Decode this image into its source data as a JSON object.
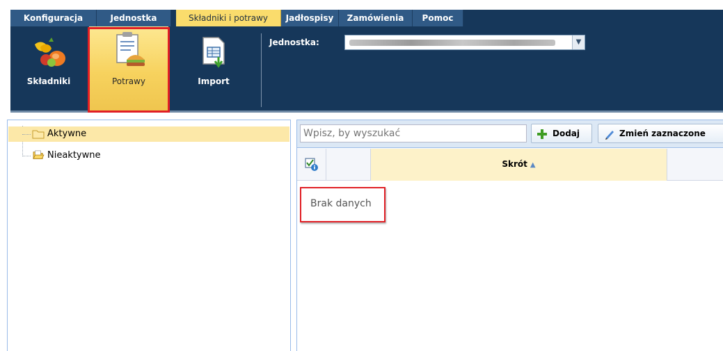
{
  "tabs": [
    {
      "label": "Konfiguracja",
      "active": false
    },
    {
      "label": "Jednostka",
      "active": false
    },
    {
      "label": "Składniki i potrawy",
      "active": true
    },
    {
      "label": "Jadłospisy",
      "active": false
    },
    {
      "label": "Zamówienia",
      "active": false
    },
    {
      "label": "Pomoc",
      "active": false
    }
  ],
  "ribbon": {
    "buttons": [
      {
        "label": "Składniki",
        "icon": "ingredients-icon",
        "active": false
      },
      {
        "label": "Potrawy",
        "icon": "dishes-clipboard-icon",
        "active": true
      },
      {
        "label": "Import",
        "icon": "import-spreadsheet-icon",
        "active": false
      }
    ],
    "unit_label": "Jednostka:",
    "unit_value_obscured": true
  },
  "tree": {
    "items": [
      {
        "label": "Aktywne",
        "selected": true,
        "icon": "folder-icon"
      },
      {
        "label": "Nieaktywne",
        "selected": false,
        "icon": "folder-open-icon"
      }
    ]
  },
  "toolbar": {
    "search_placeholder": "Wpisz, by wyszukać",
    "add_label": "Dodaj",
    "edit_label": "Zmień zaznaczone"
  },
  "grid": {
    "columns": [
      "",
      "",
      "Skrót"
    ],
    "sort_column": "Skrót",
    "sort_direction": "ascending",
    "empty_text": "Brak danych"
  },
  "colors": {
    "ribbon_bg": "#16375a",
    "tab_bg": "#305a86",
    "active_tab": "#fadc6c",
    "highlight_outline": "#e11f25",
    "selected_row": "#fce8a8"
  }
}
